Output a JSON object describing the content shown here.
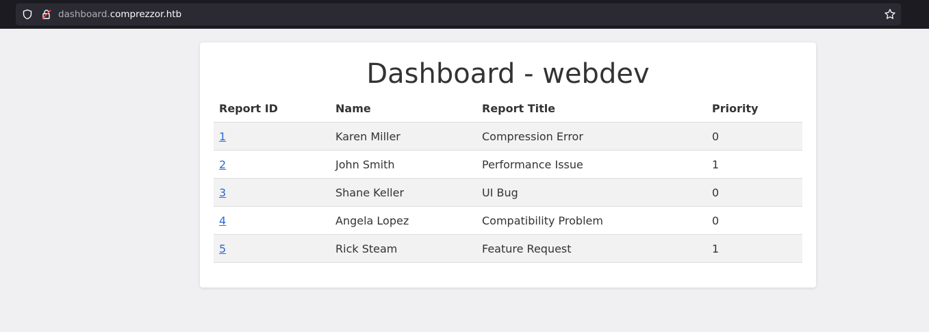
{
  "browser": {
    "url_subdomain": "dashboard.",
    "url_domain": "comprezzor.htb"
  },
  "page": {
    "title": "Dashboard - webdev"
  },
  "table": {
    "headers": [
      "Report ID",
      "Name",
      "Report Title",
      "Priority"
    ],
    "rows": [
      {
        "id": "1",
        "name": "Karen Miller",
        "title": "Compression Error",
        "priority": "0"
      },
      {
        "id": "2",
        "name": "John Smith",
        "title": "Performance Issue",
        "priority": "1"
      },
      {
        "id": "3",
        "name": "Shane Keller",
        "title": "UI Bug",
        "priority": "0"
      },
      {
        "id": "4",
        "name": "Angela Lopez",
        "title": "Compatibility Problem",
        "priority": "0"
      },
      {
        "id": "5",
        "name": "Rick Steam",
        "title": "Feature Request",
        "priority": "1"
      }
    ]
  },
  "colors": {
    "link": "#2a6bd8",
    "row_stripe": "#f2f2f2",
    "page_bg": "#f0f0f3"
  }
}
